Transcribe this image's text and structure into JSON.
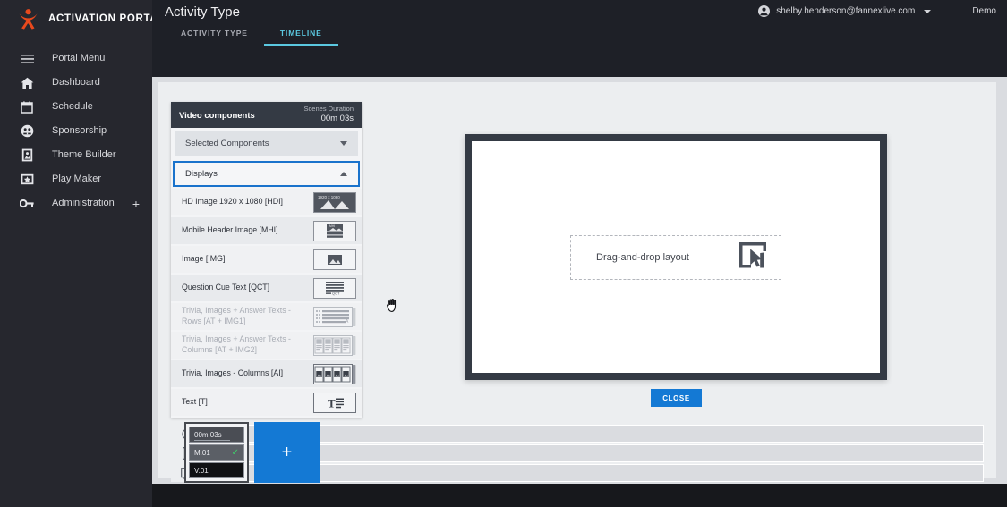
{
  "brand": {
    "name": "ACTIVATION PORTAL",
    "logo_icon": "activation-logo-icon",
    "accent": "#e8491d"
  },
  "sidebar": {
    "items": [
      {
        "label": "Portal Menu",
        "icon": "hamburger-menu-icon"
      },
      {
        "label": "Dashboard",
        "icon": "home-icon"
      },
      {
        "label": "Schedule",
        "icon": "calendar-icon"
      },
      {
        "label": "Sponsorship",
        "icon": "sponsorship-face-icon"
      },
      {
        "label": "Theme Builder",
        "icon": "theme-builder-icon"
      },
      {
        "label": "Play Maker",
        "icon": "play-maker-star-icon"
      },
      {
        "label": "Administration",
        "icon": "key-icon",
        "expand": "+"
      }
    ]
  },
  "header": {
    "title": "Activity Type",
    "tabs": [
      {
        "label": "ACTIVITY TYPE",
        "active": false
      },
      {
        "label": "TIMELINE",
        "active": true
      }
    ],
    "active_tab_color": "#5bc8e0",
    "user": {
      "email": "shelby.henderson@fannexlive.com",
      "avatar_icon": "account-circle-icon",
      "caret_icon": "chevron-down-icon"
    },
    "environment": "Demo"
  },
  "video_components": {
    "panel_title": "Video components",
    "duration_label": "Scenes Duration",
    "duration_value": "00m 03s",
    "accordions": [
      {
        "label": "Selected Components",
        "expanded": false,
        "icon": "chevron-down-icon"
      },
      {
        "label": "Displays",
        "expanded": true,
        "icon": "chevron-up-icon"
      }
    ],
    "items": [
      {
        "label": "HD Image 1920 x 1080 [HDI]",
        "icon": "hd-image-thumb-icon",
        "disabled": false,
        "selected": true
      },
      {
        "label": "Mobile Header Image [MHI]",
        "icon": "mobile-header-image-icon",
        "disabled": false,
        "selected": false
      },
      {
        "label": "Image [IMG]",
        "icon": "image-thumb-icon",
        "disabled": false,
        "selected": false
      },
      {
        "label": "Question Cue Text [QCT]",
        "icon": "question-cue-text-icon",
        "disabled": false,
        "selected": false
      },
      {
        "label": "Trivia, Images + Answer Texts - Rows [AT + IMG1]",
        "icon": "trivia-rows-icon",
        "disabled": true,
        "selected": false
      },
      {
        "label": "Trivia, Images + Answer Texts - Columns [AT + IMG2]",
        "icon": "trivia-columns-icon",
        "disabled": true,
        "selected": false
      },
      {
        "label": "Trivia, Images - Columns [AI]",
        "icon": "trivia-images-columns-icon",
        "disabled": false,
        "selected": true
      },
      {
        "label": "Text [T]",
        "icon": "text-thumb-icon",
        "disabled": false,
        "selected": false
      }
    ]
  },
  "preview": {
    "dropzone_label": "Drag-and-drop layout",
    "dropzone_icon": "drag-drop-cursor-icon",
    "close_label": "CLOSE",
    "close_color": "#1479d4"
  },
  "timeline": {
    "track_icons": [
      "clock-icon",
      "mobile-device-icon",
      "video-screen-icon"
    ],
    "scene": {
      "duration": "00m 03s",
      "mobile_track": "M.01",
      "video_track": "V.01",
      "check_icon": "check-icon",
      "check_color": "#3ecf6a"
    },
    "add_label": "+",
    "add_color": "#1479d4"
  },
  "cursor": {
    "type": "grab-hand-cursor-icon"
  }
}
